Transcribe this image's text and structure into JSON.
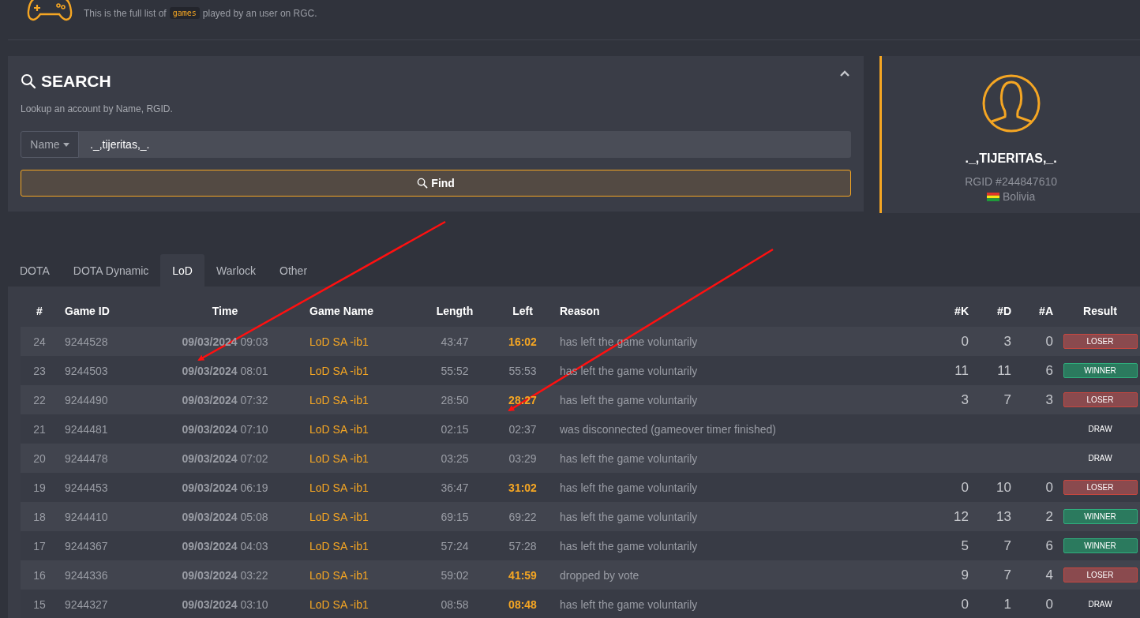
{
  "header": {
    "subtitle_before": "This is the full list of",
    "subtitle_code": "games",
    "subtitle_after": "played by an user on RGC."
  },
  "search": {
    "title": "SEARCH",
    "description": "Lookup an account by Name, RGID.",
    "filter": "Name",
    "value": "._,tijeritas,_.",
    "button": "Find"
  },
  "profile": {
    "name": "._,TIJERITAS,_.",
    "rgid": "RGID #244847610",
    "country": "Bolivia"
  },
  "tabs": [
    {
      "label": "DOTA",
      "selected": false
    },
    {
      "label": "DOTA Dynamic",
      "selected": false
    },
    {
      "label": "LoD",
      "selected": true
    },
    {
      "label": "Warlock",
      "selected": false
    },
    {
      "label": "Other",
      "selected": false
    }
  ],
  "table": {
    "columns": [
      "#",
      "Game ID",
      "Time",
      "Game Name",
      "Length",
      "Left",
      "Reason",
      "#K",
      "#D",
      "#A",
      "Result"
    ],
    "rows": [
      {
        "num": "24",
        "id": "9244528",
        "date": "09/03/2024",
        "time": "09:03",
        "name": "LoD SA -ib1",
        "length": "43:47",
        "left": "16:02",
        "left_early": true,
        "reason": "has left the game voluntarily",
        "k": "0",
        "d": "3",
        "a": "0",
        "result": "LOSER",
        "kind": "loser"
      },
      {
        "num": "23",
        "id": "9244503",
        "date": "09/03/2024",
        "time": "08:01",
        "name": "LoD SA -ib1",
        "length": "55:52",
        "left": "55:53",
        "left_early": false,
        "reason": "has left the game voluntarily",
        "k": "11",
        "d": "11",
        "a": "6",
        "result": "WINNER",
        "kind": "winner"
      },
      {
        "num": "22",
        "id": "9244490",
        "date": "09/03/2024",
        "time": "07:32",
        "name": "LoD SA -ib1",
        "length": "28:50",
        "left": "28:27",
        "left_early": true,
        "reason": "has left the game voluntarily",
        "k": "3",
        "d": "7",
        "a": "3",
        "result": "LOSER",
        "kind": "loser"
      },
      {
        "num": "21",
        "id": "9244481",
        "date": "09/03/2024",
        "time": "07:10",
        "name": "LoD SA -ib1",
        "length": "02:15",
        "left": "02:37",
        "left_early": false,
        "reason": "was disconnected (gameover timer finished)",
        "result": "DRAW",
        "kind": "draw"
      },
      {
        "num": "20",
        "id": "9244478",
        "date": "09/03/2024",
        "time": "07:02",
        "name": "LoD SA -ib1",
        "length": "03:25",
        "left": "03:29",
        "left_early": false,
        "reason": "has left the game voluntarily",
        "result": "DRAW",
        "kind": "draw"
      },
      {
        "num": "19",
        "id": "9244453",
        "date": "09/03/2024",
        "time": "06:19",
        "name": "LoD SA -ib1",
        "length": "36:47",
        "left": "31:02",
        "left_early": true,
        "reason": "has left the game voluntarily",
        "k": "0",
        "d": "10",
        "a": "0",
        "result": "LOSER",
        "kind": "loser"
      },
      {
        "num": "18",
        "id": "9244410",
        "date": "09/03/2024",
        "time": "05:08",
        "name": "LoD SA -ib1",
        "length": "69:15",
        "left": "69:22",
        "left_early": false,
        "reason": "has left the game voluntarily",
        "k": "12",
        "d": "13",
        "a": "2",
        "result": "WINNER",
        "kind": "winner"
      },
      {
        "num": "17",
        "id": "9244367",
        "date": "09/03/2024",
        "time": "04:03",
        "name": "LoD SA -ib1",
        "length": "57:24",
        "left": "57:28",
        "left_early": false,
        "reason": "has left the game voluntarily",
        "k": "5",
        "d": "7",
        "a": "6",
        "result": "WINNER",
        "kind": "winner"
      },
      {
        "num": "16",
        "id": "9244336",
        "date": "09/03/2024",
        "time": "03:22",
        "name": "LoD SA -ib1",
        "length": "59:02",
        "left": "41:59",
        "left_early": true,
        "reason": "dropped by vote",
        "k": "9",
        "d": "7",
        "a": "4",
        "result": "LOSER",
        "kind": "loser"
      },
      {
        "num": "15",
        "id": "9244327",
        "date": "09/03/2024",
        "time": "03:10",
        "name": "LoD SA -ib1",
        "length": "08:58",
        "left": "08:48",
        "left_early": true,
        "reason": "has left the game voluntarily",
        "k": "0",
        "d": "1",
        "a": "0",
        "result": "DRAW",
        "kind": "draw"
      }
    ]
  }
}
